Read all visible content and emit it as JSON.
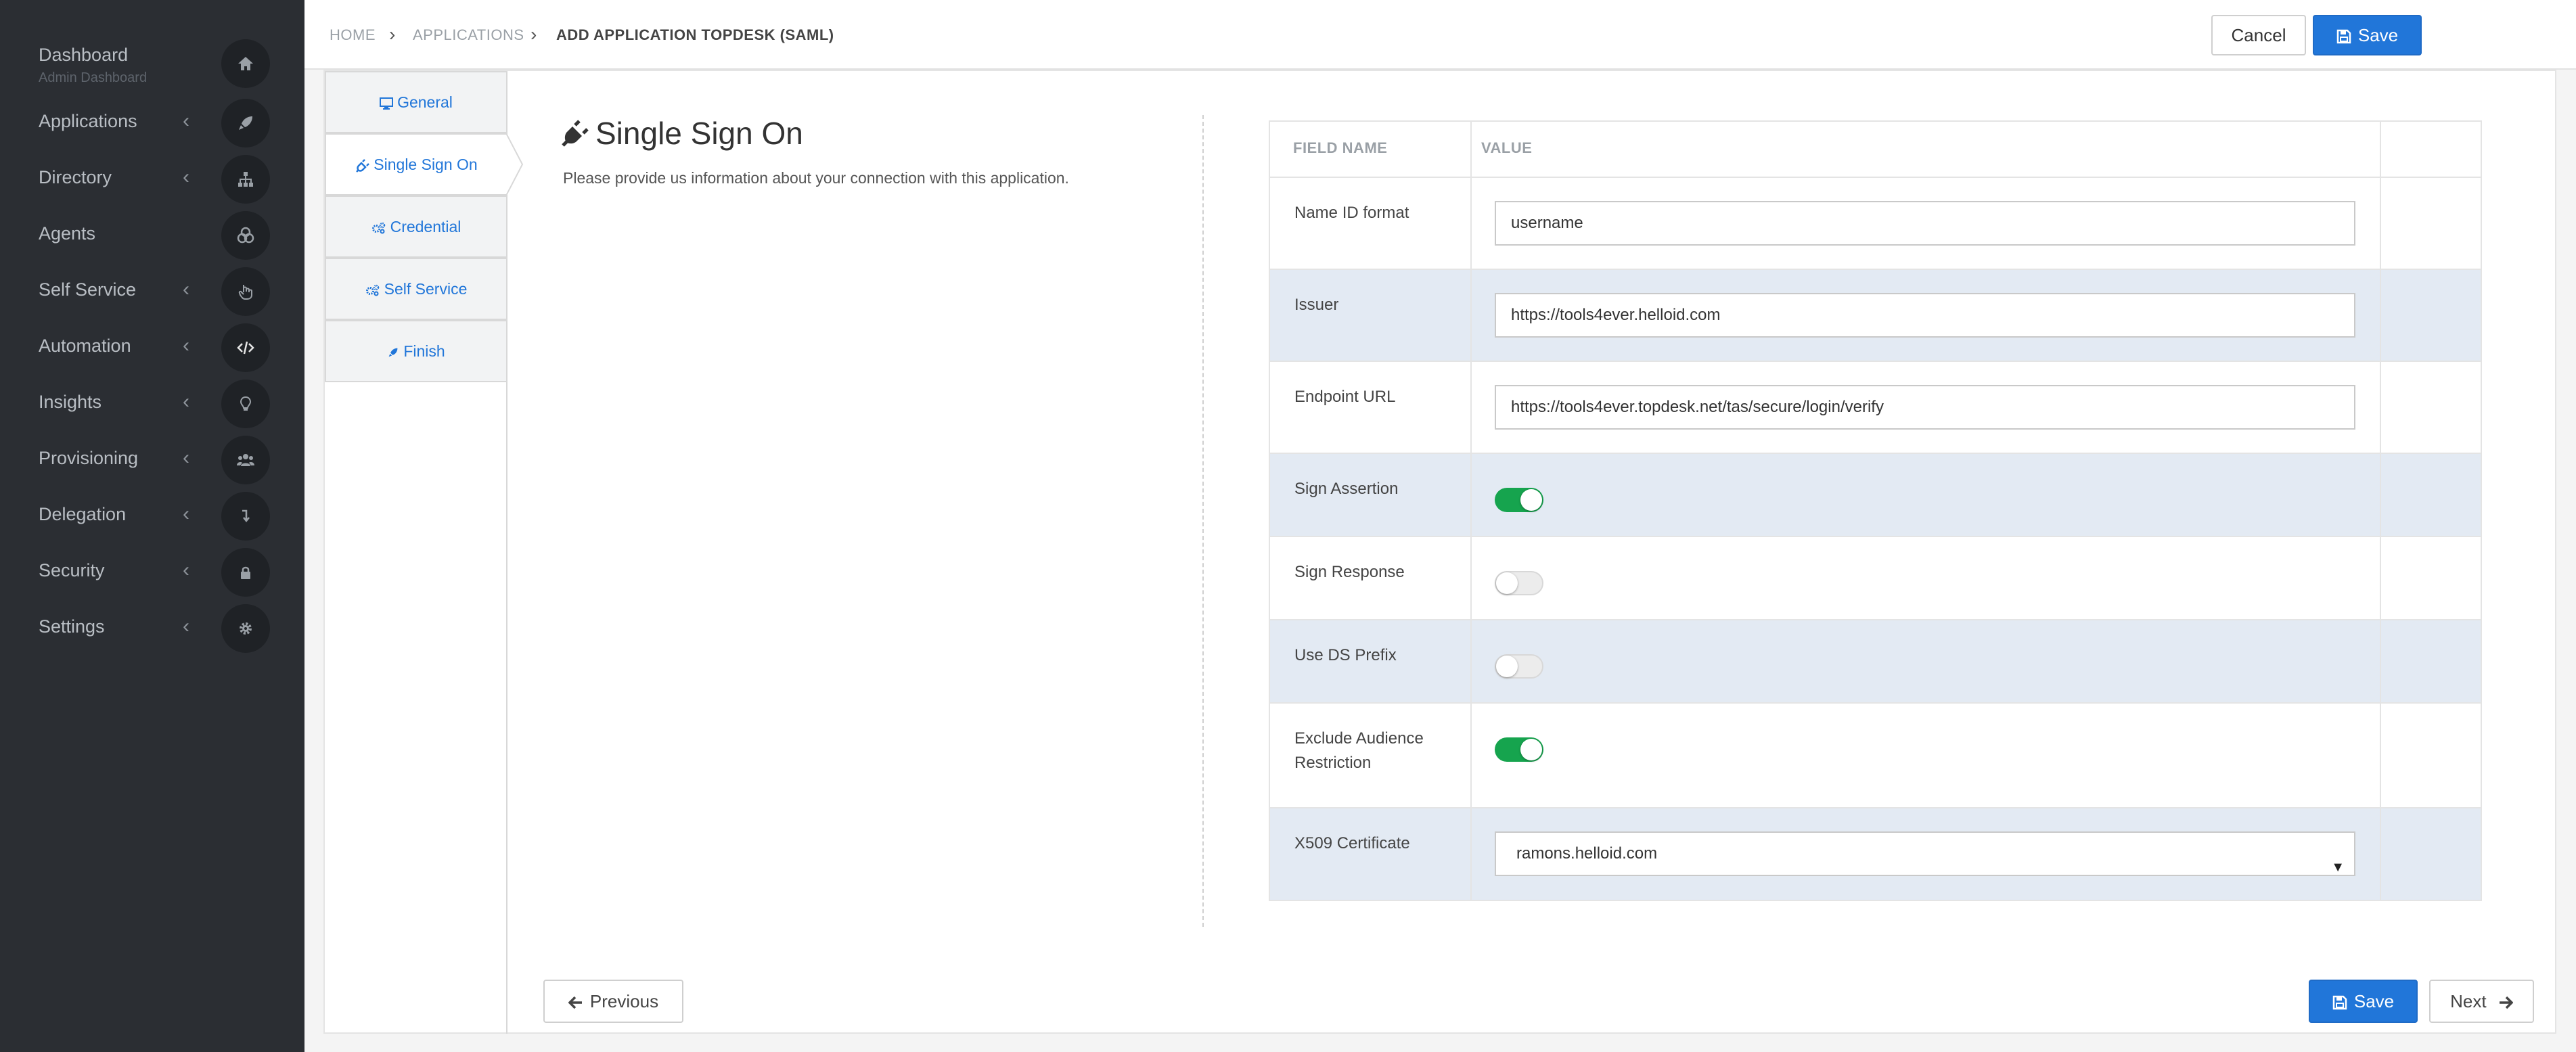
{
  "sidebar": {
    "dashboard": {
      "label": "Dashboard",
      "sublabel": "Admin Dashboard",
      "icon": "home-icon"
    },
    "items": [
      {
        "label": "Applications",
        "icon": "rocket-icon"
      },
      {
        "label": "Directory",
        "icon": "sitemap-icon"
      },
      {
        "label": "Agents",
        "icon": "agents-icon"
      },
      {
        "label": "Self Service",
        "icon": "hand-pointer-icon"
      },
      {
        "label": "Automation",
        "icon": "code-icon"
      },
      {
        "label": "Insights",
        "icon": "lightbulb-icon"
      },
      {
        "label": "Provisioning",
        "icon": "users-icon"
      },
      {
        "label": "Delegation",
        "icon": "level-down-icon"
      },
      {
        "label": "Security",
        "icon": "lock-icon"
      },
      {
        "label": "Settings",
        "icon": "gear-icon"
      }
    ]
  },
  "breadcrumb": {
    "home": "HOME",
    "applications": "APPLICATIONS",
    "current": "ADD APPLICATION TOPDESK (SAML)"
  },
  "header": {
    "cancel_label": "Cancel",
    "save_label": "Save"
  },
  "steps": [
    {
      "label": "General",
      "icon": "desktop-icon"
    },
    {
      "label": "Single Sign On",
      "icon": "plug-icon",
      "active": true
    },
    {
      "label": "Credential",
      "icon": "cogs-icon"
    },
    {
      "label": "Self Service",
      "icon": "cogs-icon"
    },
    {
      "label": "Finish",
      "icon": "rocket-icon"
    }
  ],
  "sso": {
    "title": "Single Sign On",
    "description": "Please provide us information about your connection with this application."
  },
  "table": {
    "headers": {
      "field": "FIELD NAME",
      "value": "VALUE"
    },
    "fields": {
      "name_id_format": {
        "label": "Name ID format",
        "value": "username"
      },
      "issuer": {
        "label": "Issuer",
        "value": "https://tools4ever.helloid.com"
      },
      "endpoint_url": {
        "label": "Endpoint URL",
        "value": "https://tools4ever.topdesk.net/tas/secure/login/verify"
      },
      "sign_assertion": {
        "label": "Sign Assertion",
        "checked": true
      },
      "sign_response": {
        "label": "Sign Response",
        "checked": false
      },
      "use_ds_prefix": {
        "label": "Use DS Prefix",
        "checked": false
      },
      "exclude_audience": {
        "label_line1": "Exclude Audience",
        "label_line2": "Restriction",
        "checked": true
      },
      "x509": {
        "label": "X509 Certificate",
        "value": "ramons.helloid.com"
      }
    }
  },
  "footer": {
    "previous_label": "Previous",
    "save_label": "Save",
    "next_label": "Next"
  },
  "colors": {
    "sidebar_bg": "#2b2e33",
    "primary": "#2176d9",
    "toggle_on": "#16a44e",
    "row_shaded": "#e3eaf3"
  }
}
